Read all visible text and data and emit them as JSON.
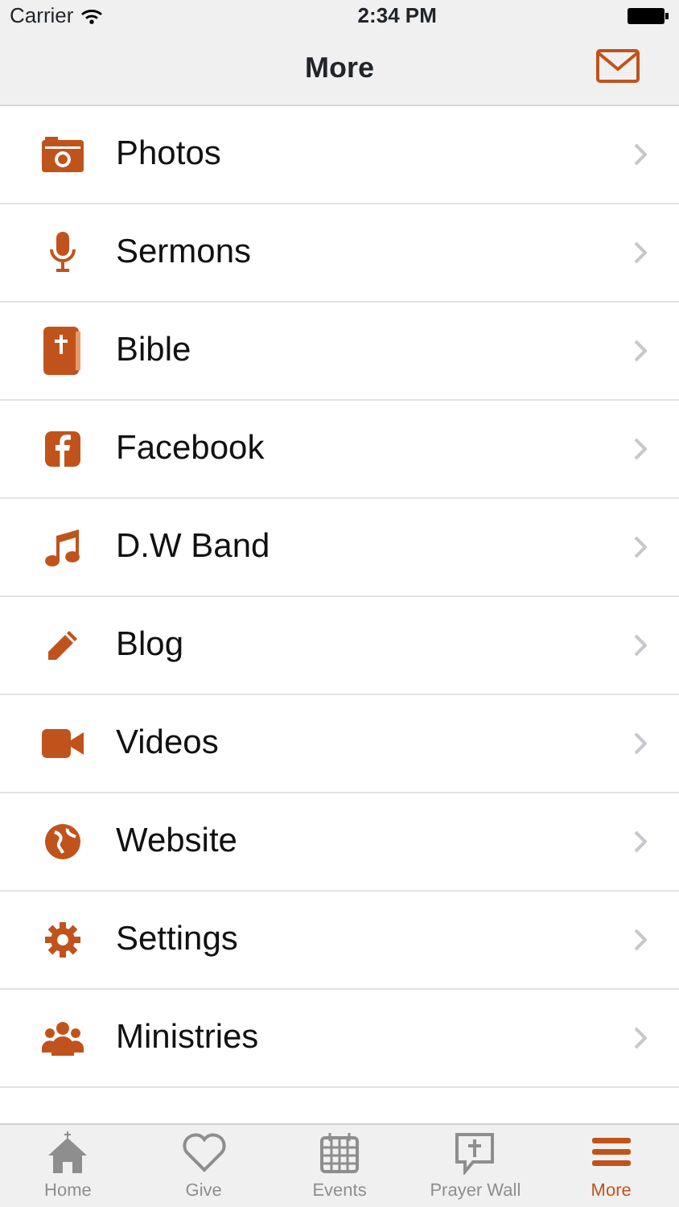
{
  "status_bar": {
    "carrier": "Carrier",
    "time": "2:34 PM"
  },
  "nav_bar": {
    "title": "More"
  },
  "menu_items": [
    {
      "label": "Photos"
    },
    {
      "label": "Sermons"
    },
    {
      "label": "Bible"
    },
    {
      "label": "Facebook"
    },
    {
      "label": "D.W Band"
    },
    {
      "label": "Blog"
    },
    {
      "label": "Videos"
    },
    {
      "label": "Website"
    },
    {
      "label": "Settings"
    },
    {
      "label": "Ministries"
    }
  ],
  "tab_bar": [
    {
      "label": "Home",
      "selected": false
    },
    {
      "label": "Give",
      "selected": false
    },
    {
      "label": "Events",
      "selected": false
    },
    {
      "label": "Prayer Wall",
      "selected": false
    },
    {
      "label": "More",
      "selected": true
    }
  ]
}
